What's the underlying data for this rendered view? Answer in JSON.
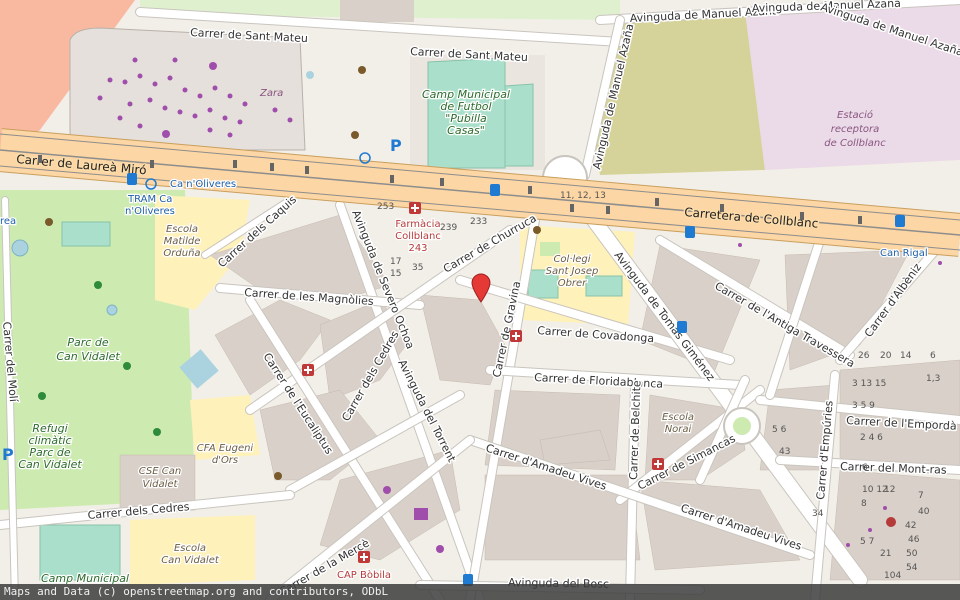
{
  "map": {
    "attribution": "Maps and Data (c) openstreetmap.org and contributors, ODbL",
    "streets": {
      "sant_mateu_1": "Carrer de Sant Mateu",
      "sant_mateu_2": "Carrer de Sant Mateu",
      "manuel_azana_1": "Avinguda de Manuel Azaña",
      "manuel_azana_2": "Avinguda de Manuel Azaña",
      "manuel_azana_3": "Avinguda de Manuel Azaña",
      "manuel_azana_vertical": "Avinguda de Manuel Azaña",
      "laurea_miro": "Carrer de Laureà Miró",
      "collblanc": "Carretera de Collblanc",
      "caquis": "Carrer dels Caquis",
      "severo_ochoa": "Avinguda de Severo Ochoa",
      "churruca": "Carrer de Churruca",
      "magnolies": "Carrer de les Magnòlies",
      "gravina": "Carrer de Gravina",
      "covadonga": "Carrer de Covadonga",
      "tomas_gimenez": "Avinguda de Tomàs Giménez",
      "antiga_travessera": "Carrer de l'Antiga Travessera",
      "albeniz": "Carrer d'Albèniz",
      "floridablanca": "Carrer de Floridablanca",
      "eucaliptus": "Carrer de l'Eucaliptus",
      "cedres_1": "Carrer dels Cedres",
      "cedres_2": "Carrer dels Cedres",
      "torrent": "Avinguda del Torrent",
      "belchite": "Carrer de Belchite",
      "simancas": "Carrer de Simancas",
      "amadeu_vives_1": "Carrer d'Amadeu Vives",
      "amadeu_vives_2": "Carrer d'Amadeu Vives",
      "emporda": "Carrer de l'Empordà",
      "mont_ras": "Carrer del Mont-ras",
      "empories": "Carrer d'Empúries",
      "moli": "Carrer del Molí",
      "merce": "Carrer de la Mercè",
      "bosc": "Avinguda del Bosc"
    },
    "places": {
      "camp_futbol": [
        "Camp Municipal",
        "de Futbol",
        "\"Pubilla",
        "Casas\""
      ],
      "estacio": [
        "Estació",
        "receptora",
        "de Collblanc"
      ],
      "zara": "Zara",
      "ca_noliveres": "Ca n'Oliveres",
      "tram_1": "TRAM Ca",
      "tram_2": "n'Oliveres",
      "can_rigal": "Can Rigal",
      "rea": "rea",
      "escola_matilde": [
        "Escola",
        "Matilde",
        "Orduña"
      ],
      "farmacia": [
        "Farmàcia",
        "Collblanc",
        "243"
      ],
      "collegi": [
        "Col·legi",
        "Sant Josep",
        "Obrer"
      ],
      "parc": [
        "Parc de",
        "Can Vidalet"
      ],
      "refugi": [
        "Refugi",
        "climàtic",
        "Parc de",
        "Can Vidalet"
      ],
      "cfa": [
        "CFA Eugeni",
        "d'Ors"
      ],
      "cse": [
        "CSE Can",
        "Vidalet"
      ],
      "escola_norai": [
        "Escola",
        "Norai"
      ],
      "escola_can_vidalet": [
        "Escola",
        "Can Vidalet"
      ],
      "camp_municipal_bottom": "Camp Municipal",
      "cap_bobila": "CAP Bòbila"
    },
    "house_numbers": {
      "n253": "253",
      "n239": "239",
      "n233": "233",
      "n17": "17",
      "n15": "15",
      "n35": "35",
      "n11_12_13": "11, 12, 13",
      "n26": "26",
      "n20": "20",
      "n14": "14",
      "n6": "6",
      "n1_3": "1,3",
      "n3_13_15": "3 13 15",
      "n3_5_9": "3 5 9",
      "n2_4_6": "2 4 6",
      "n10_12": "10 12",
      "n5_6": "5 6",
      "n43": "43",
      "n34": "34",
      "n6b": "6",
      "n8": "8",
      "n12": "12",
      "n7": "7",
      "n40": "40",
      "n42": "42",
      "n46": "46",
      "n50": "50",
      "n21": "21",
      "n54": "54",
      "n104": "104",
      "n5_7": "5 7"
    },
    "pois": {
      "parking": "P",
      "parking_left": "P"
    },
    "colors": {
      "major_road": "#fcd6a4",
      "major_road_casing": "#c99f5e",
      "park": "#cdebb0",
      "pitch": "#aae0cb",
      "school": "#fff1ba",
      "parking_area": "#eeeeee",
      "industrial": "#ebdbe8",
      "grass": "#d5e8a4",
      "building": "#d9d0c9",
      "water": "#aad3df",
      "marker": "#e53935"
    }
  }
}
